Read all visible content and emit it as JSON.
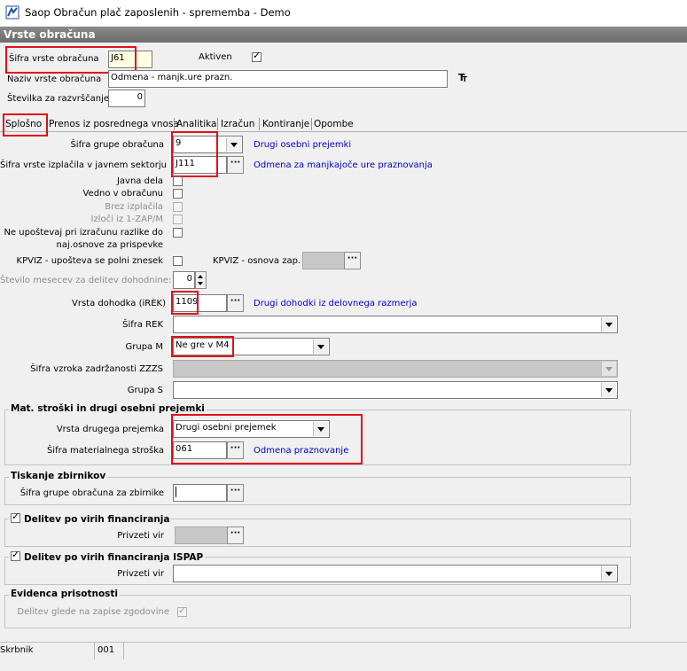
{
  "window": {
    "title": "Saop Obračun plač zaposlenih - sprememba - Demo"
  },
  "section": {
    "title": "Vrste obračuna"
  },
  "header": {
    "sifra_label": "Šifra vrste obračuna",
    "sifra_value": "J61",
    "aktiven_label": "Aktiven",
    "aktiven_checked": "✓",
    "naziv_label": "Naziv vrste obračuna",
    "naziv_value": "Odmena - manjk.ure prazn.",
    "stevilka_label": "Številka  za razvrščanje",
    "stevilka_value": "0"
  },
  "tabs": [
    "Splošno",
    "Prenos iz posrednega vnosa",
    "Analitika",
    "Izračun",
    "Kontiranje",
    "Opombe"
  ],
  "form": {
    "grupa_label": "Šifra grupe obračuna",
    "grupa_value": "9",
    "grupa_desc": "Drugi osebni prejemki",
    "izplacila_label": "Šifra vrste izplačila v javnem sektorju",
    "izplacila_value": "J111",
    "izplacila_desc": "Odmena za manjkajoče ure praznovanja",
    "javna_dela_label": "Javna dela",
    "vedno_label": "Vedno v obračunu",
    "brez_label": "Brez izplačila",
    "izloci_label": "Izloči iz 1-ZAP/M",
    "neupostevaj_label_1": "Ne upoštevaj pri izračunu razlike do",
    "neupostevaj_label_2": "naj.osnove za prispevke",
    "kpviz_label": "KPVIZ - upošteva se polni znesek",
    "kpviz_osnova_label": "KPVIZ - osnova zap.",
    "st_mesecev_label": "Število mesecev za delitev dohodnine:",
    "st_mesecev_value": "0",
    "dohodka_label": "Vrsta dohodka (iREK)",
    "dohodka_value": "1109",
    "dohodka_desc": "Drugi dohodki iz delovnega razmerja",
    "rek_label": "Šifra REK",
    "rek_value": "",
    "grupam_label": "Grupa M",
    "grupam_value": "Ne gre v M4",
    "zzzs_label": "Šifra vzroka zadržanosti ZZZS",
    "grupas_label": "Grupa S",
    "grupas_value": ""
  },
  "mat": {
    "title": "Mat. stroški in drugi osebni prejemki",
    "vrsta_label": "Vrsta drugega prejemka",
    "vrsta_value": "Drugi osebni prejemek",
    "material_label": "Šifra materialnega stroška",
    "material_value": "061",
    "material_desc": "Odmena praznovanje"
  },
  "tisk": {
    "title": "Tiskanje zbirnikov",
    "grupa_label": "Šifra grupe obračuna za zbirnike"
  },
  "delitev": {
    "title": "Delitev po virih financiranja",
    "privzeti_label": "Privzeti vir"
  },
  "delitev_ispap": {
    "title": "Delitev po virih financiranja ISPAP",
    "privzeti_label": "Privzeti vir"
  },
  "evidenca": {
    "title": "Evidenca prisotnosti",
    "delitev_label": "Delitev glede na zapise zgodovine"
  },
  "status": {
    "label": "Skrbnik",
    "value": "001"
  }
}
